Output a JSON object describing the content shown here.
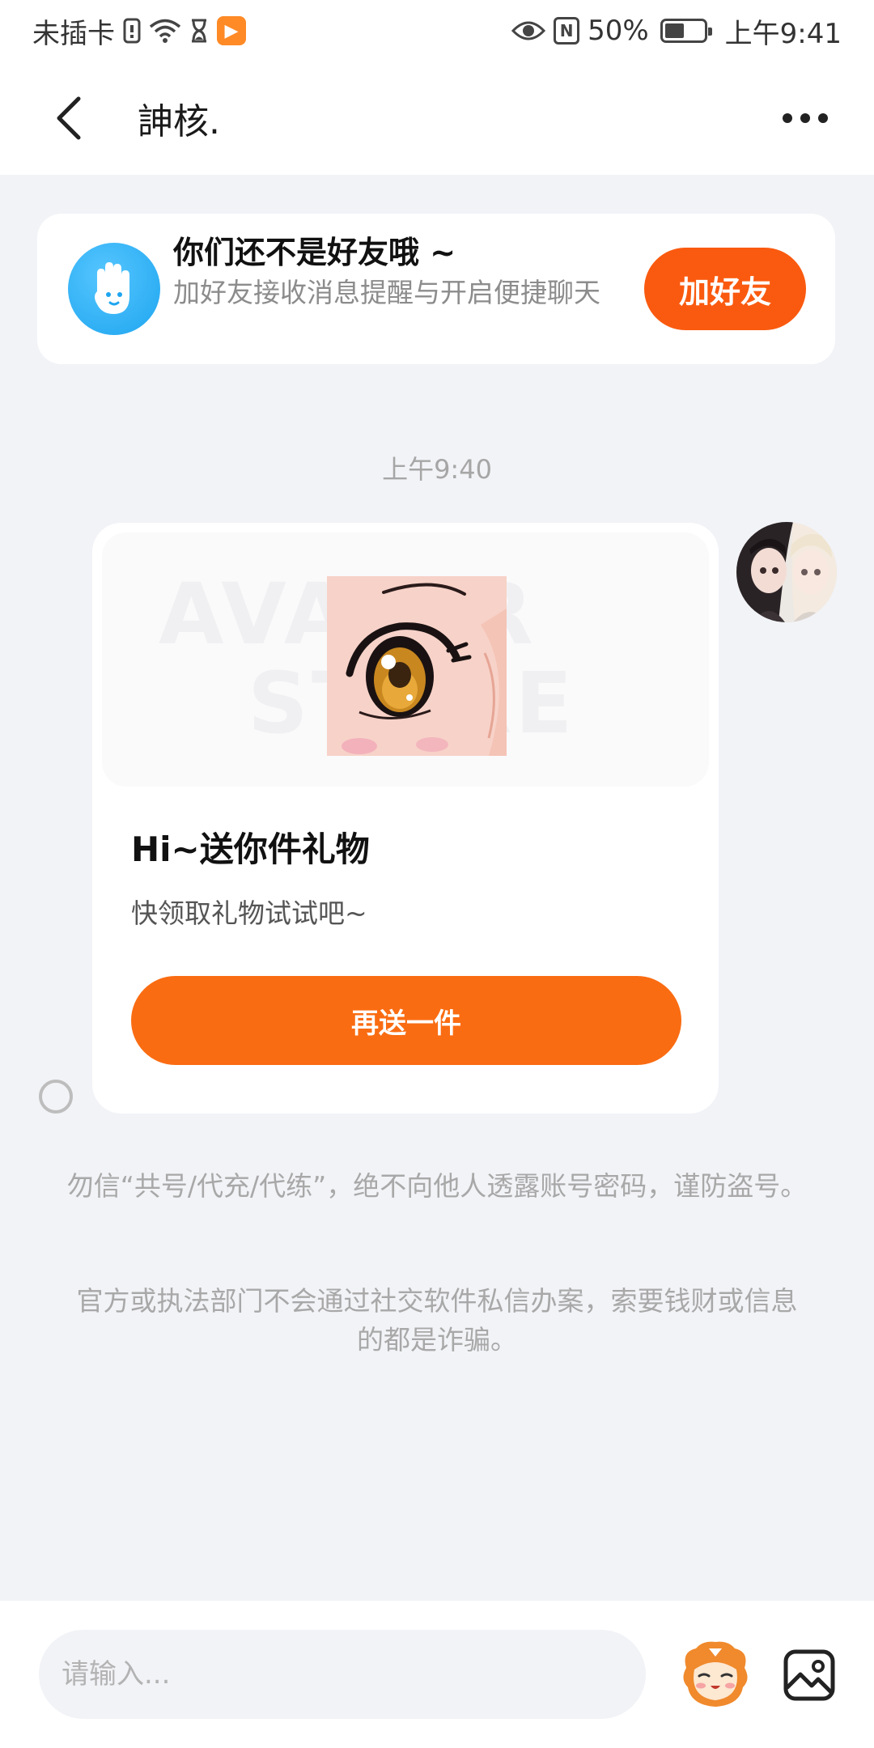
{
  "status_bar": {
    "carrier": "未插卡",
    "battery": "50%",
    "battery_level": 0.5,
    "time": "上午9:41"
  },
  "nav": {
    "title": "訷核."
  },
  "friend_banner": {
    "title": "你们还不是好友哦 ~",
    "subtitle": "加好友接收消息提醒与开启便捷聊天",
    "button_label": "加好友"
  },
  "chat": {
    "timestamp": "上午9:40",
    "gift_card": {
      "watermark_line1": "AVATAR",
      "watermark_line2": "STORE",
      "title": "Hi~送你件礼物",
      "description": "快领取礼物试试吧~",
      "button_label": "再送一件"
    }
  },
  "notices": {
    "security_1": "勿信“共号/代充/代练”，绝不向他人透露账号密码，谨防盗号。",
    "security_2": "官方或执法部门不会通过社交软件私信办案，索要钱财或信息的都是诈骗。"
  },
  "input_bar": {
    "placeholder": "请输入..."
  },
  "colors": {
    "accent_orange": "#fa5a0f",
    "button_orange": "#fa6c12",
    "friend_icon_blue": "#1ea5ef",
    "page_bg": "#f2f3f7"
  },
  "icons": [
    "back-arrow-icon",
    "more-dots-icon",
    "waving-hand-icon",
    "emoji-mascot-icon",
    "image-icon",
    "wifi-icon",
    "sim-icon",
    "hourglass-icon",
    "eye-icon",
    "nfc-icon",
    "battery-icon"
  ]
}
